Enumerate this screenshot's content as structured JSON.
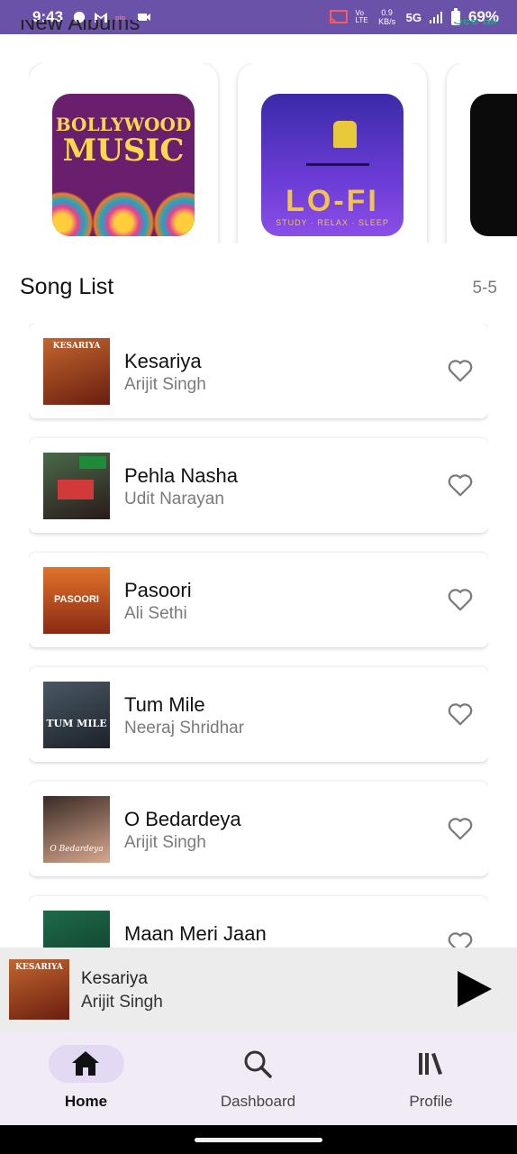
{
  "status_bar": {
    "time": "9:43",
    "network_speed": "0.9 KB/s",
    "network_type": "5G",
    "battery": "69%",
    "bg_color": "#6a52a8"
  },
  "albums": {
    "title_fragment": "New Albums",
    "see_all_fragment": "See all",
    "items": [
      {
        "cover_line1": "BOLLYWOOD",
        "cover_line2": "MUSIC",
        "icon": "bollywood-album-art"
      },
      {
        "cover_text": "LO-FI",
        "cover_subtext": "STUDY · RELAX · SLEEP",
        "icon": "lofi-album-art"
      },
      {
        "icon": "dark-album-art"
      }
    ]
  },
  "song_list": {
    "title": "Song List",
    "count": "5-5",
    "songs": [
      {
        "title": "Kesariya",
        "artist": "Arijit Singh",
        "cover_text": "KESARIYA",
        "cover_color": "#8a3a1e"
      },
      {
        "title": "Pehla Nasha",
        "artist": "Udit Narayan",
        "cover_text": "",
        "cover_color": "#2a3d2a"
      },
      {
        "title": "Pasoori",
        "artist": "Ali Sethi",
        "cover_text": "PASOORI",
        "cover_color": "#d2551e"
      },
      {
        "title": "Tum Mile",
        "artist": "Neeraj Shridhar",
        "cover_text": "TUM MILE",
        "cover_color": "#2c3a44"
      },
      {
        "title": "O Bedardeya",
        "artist": "Arijit Singh",
        "cover_text": "O Bedardeya",
        "cover_color": "#b88470"
      },
      {
        "title": "Maan Meri Jaan",
        "artist": "",
        "cover_text": "",
        "cover_color": "#1f6a4a"
      }
    ]
  },
  "mini_player": {
    "title": "Kesariya",
    "artist": "Arijit Singh",
    "cover_text": "KESARIYA"
  },
  "bottom_nav": {
    "items": [
      {
        "label": "Home",
        "icon": "home-icon",
        "active": true
      },
      {
        "label": "Dashboard",
        "icon": "search-icon",
        "active": false
      },
      {
        "label": "Profile",
        "icon": "library-icon",
        "active": false
      }
    ]
  },
  "colors": {
    "accent": "#6a52a8",
    "nav_bg": "#f1ebf5",
    "nav_active_pill": "#e3d9f2",
    "mini_player_bg": "#ececec"
  }
}
